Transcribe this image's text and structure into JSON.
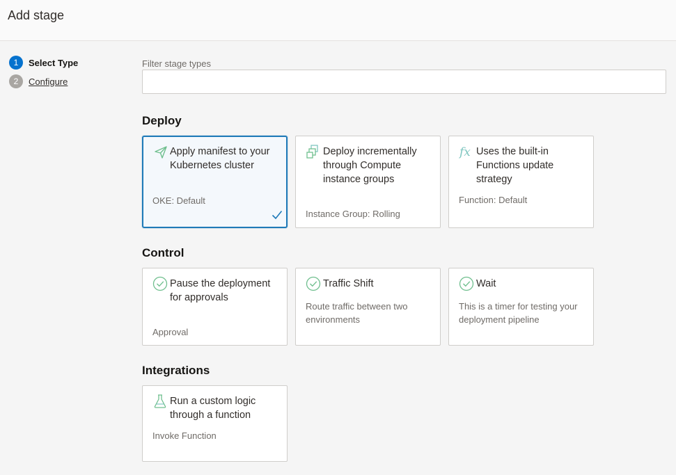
{
  "header": {
    "title": "Add stage"
  },
  "steps": [
    {
      "num": "1",
      "label": "Select Type"
    },
    {
      "num": "2",
      "label": "Configure"
    }
  ],
  "filter": {
    "label": "Filter stage types",
    "value": "",
    "placeholder": ""
  },
  "sections": {
    "deploy": {
      "title": "Deploy",
      "cards": [
        {
          "icon": "paper-plane-icon",
          "title": "Apply manifest to your Kubernetes cluster",
          "subtitle": "OKE: Default",
          "selected": true
        },
        {
          "icon": "instance-group-icon",
          "title": "Deploy incrementally through Compute instance groups",
          "subtitle": "Instance Group: Rolling",
          "selected": false
        },
        {
          "icon": "function-fx-icon",
          "title": "Uses the built-in Functions update strategy",
          "subtitle": "Function: Default",
          "selected": false
        }
      ]
    },
    "control": {
      "title": "Control",
      "cards": [
        {
          "icon": "check-circle-icon",
          "title": "Pause the deployment for approvals",
          "subtitle": "Approval",
          "selected": false
        },
        {
          "icon": "check-circle-icon",
          "title": "Traffic Shift",
          "subtitle": "Route traffic between two environments",
          "selected": false
        },
        {
          "icon": "check-circle-icon",
          "title": "Wait",
          "subtitle": "This is a timer for testing your deployment pipeline",
          "selected": false
        }
      ]
    },
    "integrations": {
      "title": "Integrations",
      "cards": [
        {
          "icon": "flask-icon",
          "title": "Run a custom logic through a function",
          "subtitle": "Invoke Function",
          "selected": false
        }
      ]
    }
  },
  "colors": {
    "accent": "#0572ce",
    "selected_border": "#1f7ab8",
    "icon_green": "#6fbf8e",
    "icon_teal": "#7fc6c0"
  }
}
